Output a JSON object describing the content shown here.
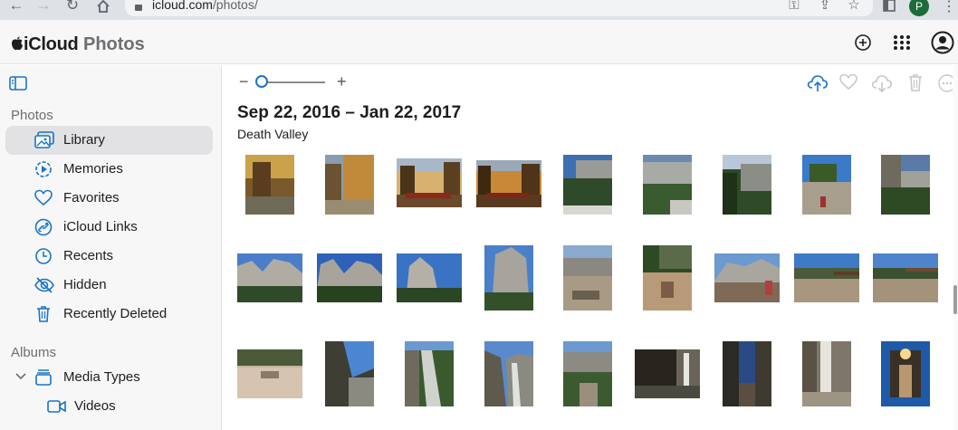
{
  "browser": {
    "url_host": "icloud.com",
    "url_path": "/photos/",
    "profile_initial": "P"
  },
  "app": {
    "brand_name": "iCloud",
    "brand_section": "Photos"
  },
  "sidebar": {
    "photos_title": "Photos",
    "albums_title": "Albums",
    "items": [
      {
        "label": "Library",
        "icon": "library-icon",
        "active": true
      },
      {
        "label": "Memories",
        "icon": "memories-icon"
      },
      {
        "label": "Favorites",
        "icon": "heart-icon"
      },
      {
        "label": "iCloud Links",
        "icon": "link-icon"
      },
      {
        "label": "Recents",
        "icon": "clock-icon"
      },
      {
        "label": "Hidden",
        "icon": "eye-slash-icon"
      },
      {
        "label": "Recently Deleted",
        "icon": "trash-icon"
      }
    ],
    "album_items": [
      {
        "label": "Media Types",
        "icon": "media-types-icon"
      },
      {
        "label": "Videos",
        "icon": "video-icon"
      }
    ]
  },
  "main": {
    "date_range": "Sep 22, 2016 – Jan 22, 2017",
    "location": "Death Valley",
    "zoom_minus": "−",
    "zoom_plus": "+"
  },
  "colors": {
    "accent": "#1a73c8",
    "active_item_bg": "#e2e2e4",
    "sidebar_bg": "#f7f7f7"
  }
}
